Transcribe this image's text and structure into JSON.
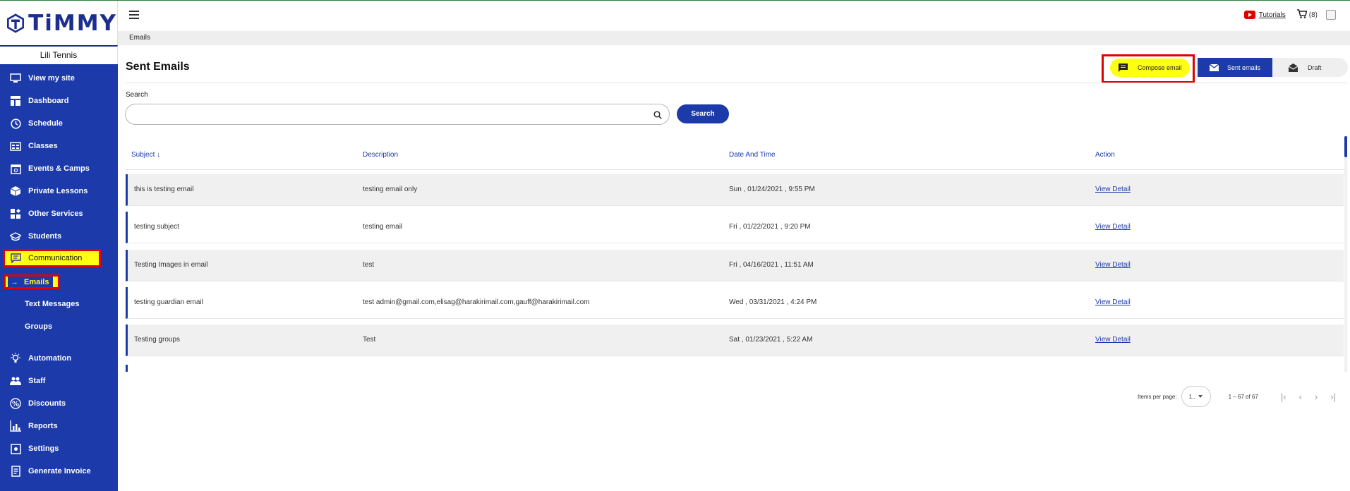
{
  "brand": {
    "name": "TiMMY",
    "user": "Lili Tennis"
  },
  "sidebar": {
    "items": [
      {
        "label": "View my site",
        "icon": "monitor-icon"
      },
      {
        "label": "Dashboard",
        "icon": "dashboard-icon"
      },
      {
        "label": "Schedule",
        "icon": "clock-icon"
      },
      {
        "label": "Classes",
        "icon": "classes-icon"
      },
      {
        "label": "Events & Camps",
        "icon": "calendar-icon"
      },
      {
        "label": "Private Lessons",
        "icon": "box-icon"
      },
      {
        "label": "Other Services",
        "icon": "services-icon"
      },
      {
        "label": "Students",
        "icon": "graduation-cap-icon"
      },
      {
        "label": "Communication",
        "icon": "chat-icon"
      },
      {
        "label": "Automation",
        "icon": "bulb-icon"
      },
      {
        "label": "Staff",
        "icon": "people-icon"
      },
      {
        "label": "Discounts",
        "icon": "percent-icon"
      },
      {
        "label": "Reports",
        "icon": "chart-icon"
      },
      {
        "label": "Settings",
        "icon": "settings-icon"
      },
      {
        "label": "Generate Invoice",
        "icon": "invoice-icon"
      }
    ],
    "sub_items": [
      "Emails",
      "Text Messages",
      "Groups"
    ]
  },
  "header": {
    "tutorials": "Tutorials",
    "cart_count": "(8)"
  },
  "breadcrumb": "Emails",
  "main": {
    "title": "Sent Emails",
    "compose": "Compose email",
    "tabs": [
      "Sent emails",
      "Draft"
    ],
    "search_label": "Search",
    "search_value": "",
    "search_button": "Search"
  },
  "table": {
    "columns": [
      "Subject",
      "Description",
      "Date And Time",
      "Action"
    ],
    "rows": [
      {
        "subject": "this is testing email",
        "description": "testing email only",
        "datetime": "Sun , 01/24/2021 , 9:55 PM",
        "action": "View Detail"
      },
      {
        "subject": "testing subject",
        "description": "testing email",
        "datetime": "Fri , 01/22/2021 , 9:20 PM",
        "action": "View Detail"
      },
      {
        "subject": "Testing Images in email",
        "description": "test",
        "datetime": "Fri , 04/16/2021 , 11:51 AM",
        "action": "View Detail"
      },
      {
        "subject": "testing guardian email",
        "description": "test admin@gmail.com,elisag@harakirimail.com,gauff@harakirimail.com",
        "datetime": "Wed , 03/31/2021 , 4:24 PM",
        "action": "View Detail"
      },
      {
        "subject": "Testing groups",
        "description": "Test",
        "datetime": "Sat , 01/23/2021 , 5:22 AM",
        "action": "View Detail"
      }
    ]
  },
  "paginator": {
    "label": "Items per page:",
    "value": "1..",
    "range": "1 – 67 of 67"
  },
  "colors": {
    "primary": "#1c3aa9",
    "highlight": "#ffff14",
    "annotation": "#e00000"
  }
}
